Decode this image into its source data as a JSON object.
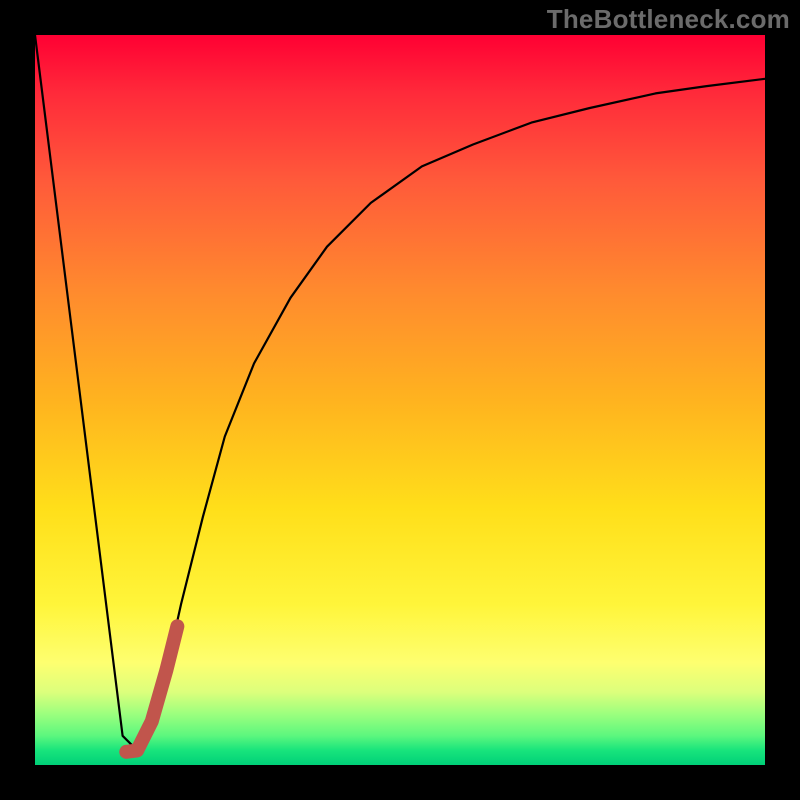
{
  "watermark": "TheBottleneck.com",
  "colors": {
    "frame": "#000000",
    "curve_thin": "#000000",
    "curve_thick": "#c1554c"
  },
  "chart_data": {
    "type": "line",
    "title": "",
    "xlabel": "",
    "ylabel": "",
    "xlim": [
      0,
      100
    ],
    "ylim": [
      0,
      100
    ],
    "grid": false,
    "series": [
      {
        "name": "black-curve",
        "x": [
          0,
          5,
          10,
          12,
          14,
          16,
          18,
          20,
          23,
          26,
          30,
          35,
          40,
          46,
          53,
          60,
          68,
          76,
          85,
          92,
          100
        ],
        "values": [
          100,
          60,
          20,
          4,
          2,
          6,
          13,
          22,
          34,
          45,
          55,
          64,
          71,
          77,
          82,
          85,
          88,
          90,
          92,
          93,
          94
        ]
      },
      {
        "name": "highlight-segment",
        "x": [
          12.5,
          14.0,
          16.0,
          18.0,
          19.5
        ],
        "values": [
          1.8,
          2.0,
          6.0,
          13.0,
          19.0
        ]
      }
    ]
  }
}
